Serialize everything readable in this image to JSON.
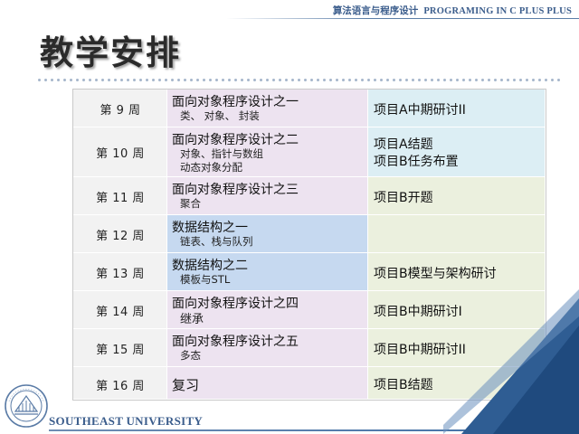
{
  "header": {
    "course_cn": "算法语言与程序设计",
    "course_en": "PROGRAMING IN C PLUS PLUS"
  },
  "title": "教学安排",
  "rows": [
    {
      "week": "第 9 周",
      "topic": "面向对象程序设计之一",
      "sub": [
        "类、 对象、 封装"
      ],
      "projects": [
        "项目A中期研讨II"
      ]
    },
    {
      "week": "第 10 周",
      "topic": "面向对象程序设计之二",
      "sub": [
        "对象、指针与数组",
        "动态对象分配"
      ],
      "projects": [
        "项目A结题",
        "项目B任务布置"
      ]
    },
    {
      "week": "第 11 周",
      "topic": "面向对象程序设计之三",
      "sub": [
        "聚合"
      ],
      "projects": [
        "项目B开题"
      ]
    },
    {
      "week": "第 12 周",
      "topic": "数据结构之一",
      "sub": [
        "链表、栈与队列"
      ],
      "projects": []
    },
    {
      "week": "第 13 周",
      "topic": "数据结构之二",
      "sub": [
        "模板与STL"
      ],
      "projects": [
        "项目B模型与架构研讨"
      ]
    },
    {
      "week": "第 14 周",
      "topic": "面向对象程序设计之四",
      "sub": [
        "继承"
      ],
      "projects": [
        "项目B中期研讨I"
      ]
    },
    {
      "week": "第 15 周",
      "topic": "面向对象程序设计之五",
      "sub": [
        "多态"
      ],
      "projects": [
        "项目B中期研讨II"
      ]
    },
    {
      "week": "第 16 周",
      "topic": "复习",
      "sub": [],
      "projects": [
        "项目B结题"
      ]
    }
  ],
  "footer": {
    "university": "SOUTHEAST UNIVERSITY"
  },
  "colors": {
    "header_text": "#3b5d8c",
    "week_cell": "#f2f2f2",
    "topic_oop": "#ede3f0",
    "topic_ds": "#c6d9f0",
    "project_a": "#dceef4",
    "project_b": "#ebf0de"
  }
}
